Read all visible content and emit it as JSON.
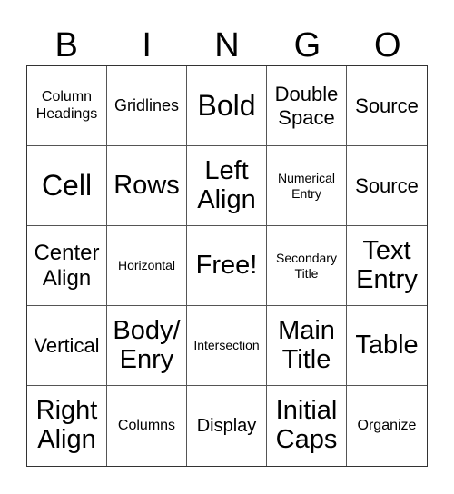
{
  "header": [
    "B",
    "I",
    "N",
    "G",
    "O"
  ],
  "cells": [
    "Column Headings",
    "Gridlines",
    "Bold",
    "Double Space",
    "Source",
    "Cell",
    "Rows",
    "Left Align",
    "Numerical Entry",
    "Source",
    "Center Align",
    "Horizontal",
    "Free!",
    "Secondary Title",
    "Text Entry",
    "Vertical",
    "Body/ Enry",
    "Intersection",
    "Main Title",
    "Table",
    "Right Align",
    "Columns",
    "Display",
    "Initial Caps",
    "Organize"
  ]
}
